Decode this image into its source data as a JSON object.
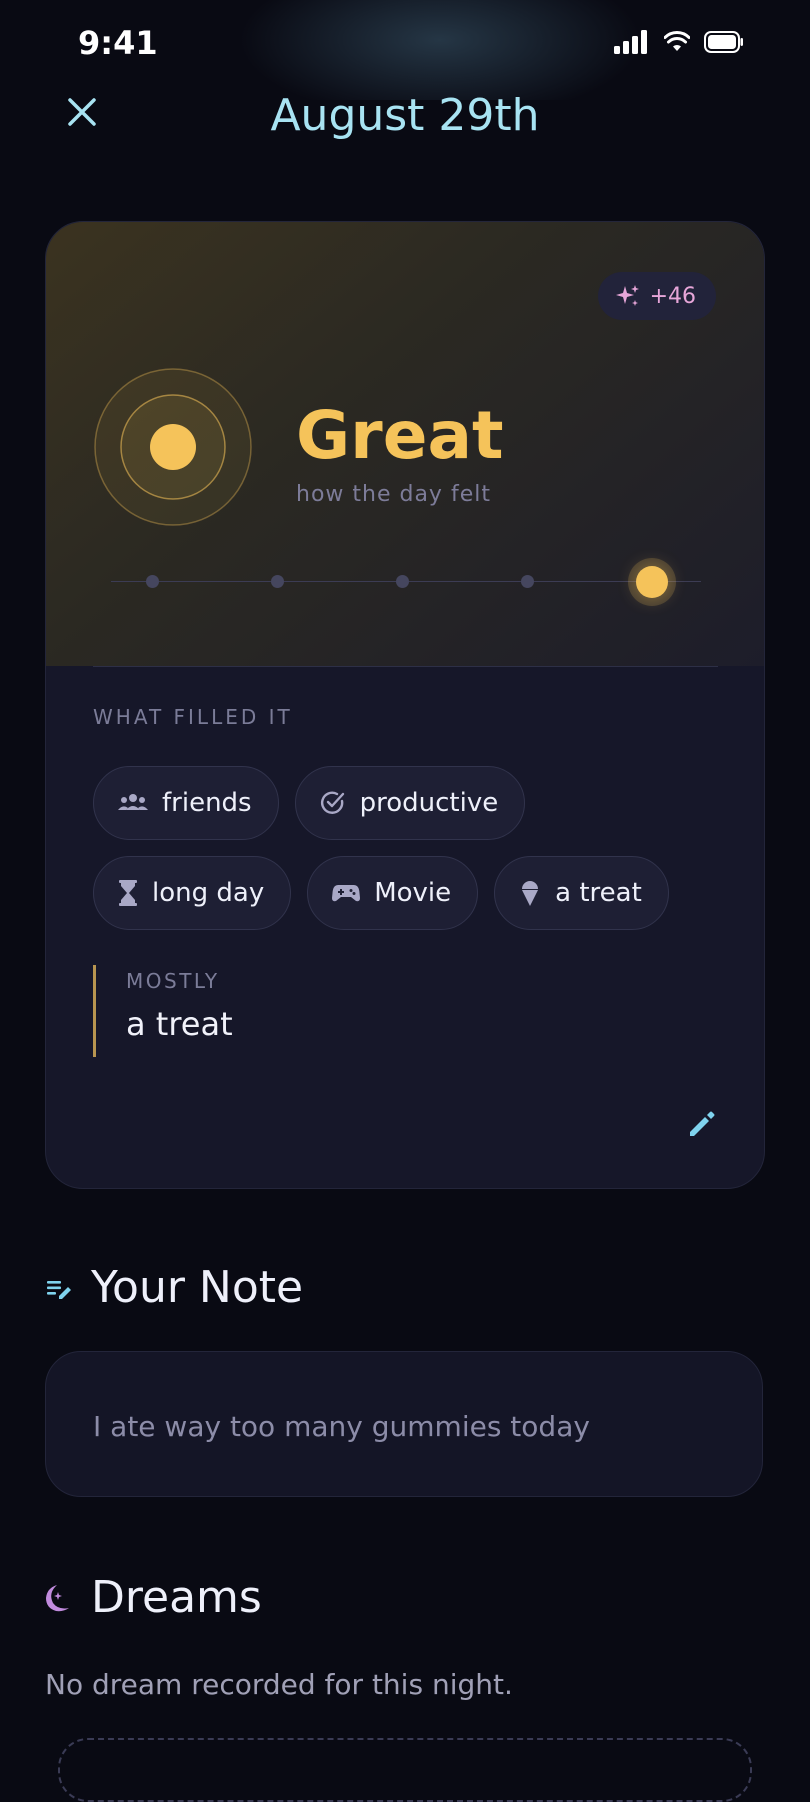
{
  "status_bar": {
    "time": "9:41"
  },
  "header": {
    "title": "August 29th"
  },
  "card": {
    "badge": {
      "text": "+46",
      "color": "#e7a6d9"
    },
    "mood": {
      "label": "Great",
      "subtitle": "how the day felt",
      "level": 5,
      "level_max": 5,
      "color": "#f5c35a"
    },
    "filled_label": "WHAT FILLED IT",
    "tags": [
      {
        "label": "friends",
        "icon": "group-icon"
      },
      {
        "label": "productive",
        "icon": "check-circle-icon"
      },
      {
        "label": "long day",
        "icon": "hourglass-icon"
      },
      {
        "label": "Movie",
        "icon": "gamepad-icon"
      },
      {
        "label": "a treat",
        "icon": "ice-cream-icon"
      }
    ],
    "mostly": {
      "label": "MOSTLY",
      "value": "a treat"
    }
  },
  "note": {
    "section_title": "Your Note",
    "text": "I ate way too many gummies today"
  },
  "dreams": {
    "section_title": "Dreams",
    "empty_text": "No dream recorded for this night."
  },
  "colors": {
    "accent": "#a8e3f2",
    "mood_gold": "#f5c35a",
    "background": "#090a13",
    "card": "#161729"
  }
}
